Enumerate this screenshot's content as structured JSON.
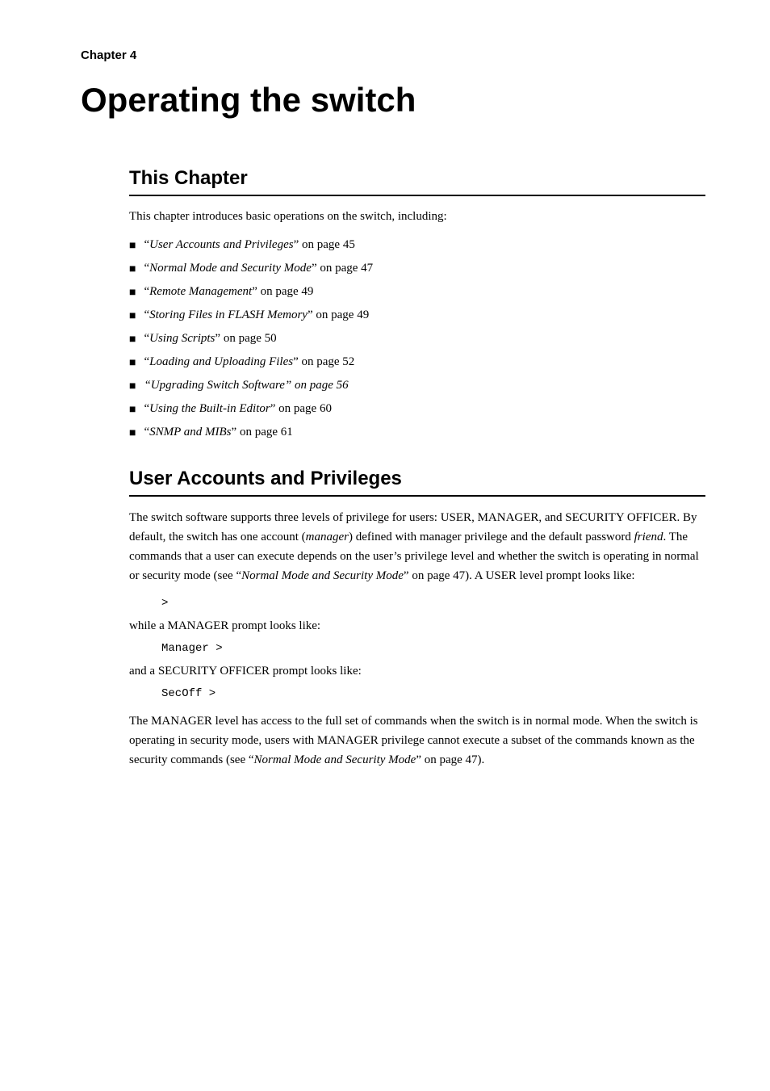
{
  "chapter": {
    "label": "Chapter 4",
    "title": "Operating the switch"
  },
  "this_chapter": {
    "heading": "This Chapter",
    "intro": "This chapter introduces basic operations on the switch, including:",
    "items": [
      {
        "text": "“User Accounts and Privileges” on page 45",
        "italic_part": "User Accounts and Privileges",
        "suffix": "” on page 45"
      },
      {
        "text": "“Normal Mode and Security Mode” on page 47",
        "italic_part": "Normal Mode and Security Mode",
        "suffix": "” on page 47"
      },
      {
        "text": "“Remote Management” on page 49",
        "italic_part": "Remote Management",
        "suffix": "” on page 49"
      },
      {
        "text": "“Storing Files in FLASH Memory” on page 49",
        "italic_part": "Storing Files in FLASH Memory",
        "suffix": "” on page 49"
      },
      {
        "text": "“Using Scripts” on page 50",
        "italic_part": "Using Scripts",
        "suffix": "” on page 50"
      },
      {
        "text": "“Loading and Uploading Files” on page 52",
        "italic_part": "Loading and Uploading Files",
        "suffix": "” on page 52"
      },
      {
        "text": "“Upgrading Switch Software” on page 56",
        "italic_part": "Upgrading Switch Software” on page 56",
        "suffix": ""
      },
      {
        "text": "“Using the Built-in Editor” on page 60",
        "italic_part": "Using the Built-in Editor",
        "suffix": "” on page 60"
      },
      {
        "text": "“SNMP and MIBs” on page 61",
        "italic_part": "SNMP and MIBs",
        "suffix": "” on page 61"
      }
    ]
  },
  "user_accounts": {
    "heading": "User Accounts and Privileges",
    "para1": "The switch software supports three levels of privilege for users: USER, MANAGER, and SECURITY OFFICER. By default, the switch has one account (manager) defined with manager privilege and the default password friend. The commands that a user can execute depends on the user’s privilege level and whether the switch is operating in normal or security mode (see “Normal Mode and Security Mode” on page 47). A USER level prompt looks like:",
    "user_prompt": ">",
    "while_manager": "while a MANAGER prompt looks like:",
    "manager_prompt": "Manager >",
    "and_security": "and a SECURITY OFFICER prompt looks like:",
    "secoff_prompt": "SecOff >",
    "para2": "The MANAGER level has access to the full set of commands when the switch is in normal mode. When the switch is operating in security mode, users with MANAGER privilege cannot execute a subset of the commands known as the security commands (see “Normal Mode and Security Mode” on page 47)."
  }
}
